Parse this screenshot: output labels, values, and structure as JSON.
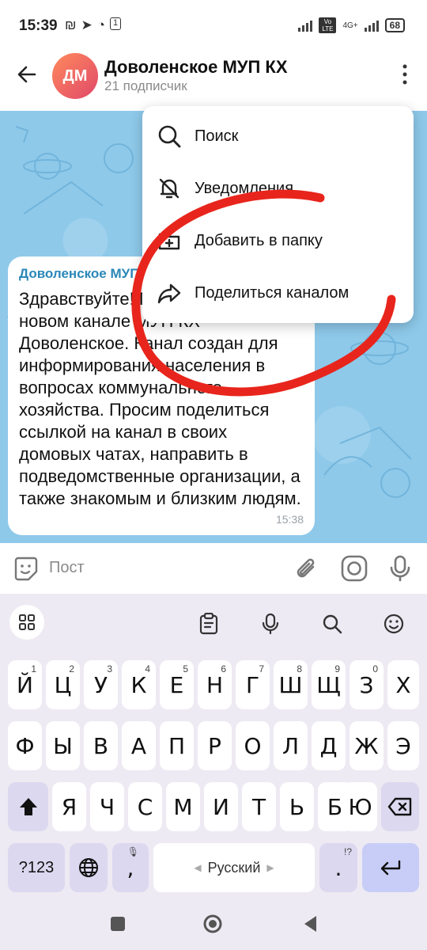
{
  "status_bar": {
    "time": "15:39",
    "battery": "68",
    "network": "4G+",
    "volte": "Vo LTE",
    "notification_count": "1"
  },
  "header": {
    "avatar_initials": "ДМ",
    "title": "Доволенское МУП КХ",
    "subtitle": "21 подписчик"
  },
  "menu": {
    "items": [
      {
        "label": "Поиск",
        "icon": "search-icon"
      },
      {
        "label": "Уведомления",
        "icon": "bell-off-icon"
      },
      {
        "label": "Добавить в папку",
        "icon": "folder-add-icon"
      },
      {
        "label": "Поделиться каналом",
        "icon": "share-icon"
      }
    ]
  },
  "message": {
    "author": "Доволенское МУП КХ",
    "text": "Здравствуйте! Приветствуем вас в новом канале МУП КХ Доволенское. Канал создан для информирования населения в вопросах коммунального хозяйства. Просим поделиться ссылкой на канал в своих домовых чатах, направить в подведомственные организации, а также знакомым и близким людям.",
    "time": "15:38"
  },
  "input": {
    "placeholder": "Пост"
  },
  "keyboard": {
    "row1": [
      {
        "k": "Й",
        "n": "1"
      },
      {
        "k": "Ц",
        "n": "2"
      },
      {
        "k": "У",
        "n": "3"
      },
      {
        "k": "К",
        "n": "4"
      },
      {
        "k": "Е",
        "n": "5"
      },
      {
        "k": "Н",
        "n": "6"
      },
      {
        "k": "Г",
        "n": "7"
      },
      {
        "k": "Ш",
        "n": "8"
      },
      {
        "k": "Щ",
        "n": "9"
      },
      {
        "k": "З",
        "n": "0"
      },
      {
        "k": "Х",
        "n": ""
      }
    ],
    "row2": [
      "Ф",
      "Ы",
      "В",
      "А",
      "П",
      "Р",
      "О",
      "Л",
      "Д",
      "Ж",
      "Э"
    ],
    "row3": [
      "Я",
      "Ч",
      "С",
      "М",
      "И",
      "Т",
      "Ь",
      "Б",
      "Ю"
    ],
    "symbols_label": "?123",
    "comma": ",",
    "space_label": "Русский",
    "period": ".",
    "period_hint": "!?"
  },
  "colors": {
    "accent": "#2a88b8",
    "chat_bg": "#8ec9ea",
    "annotation": "#e8251c",
    "enter_key": "#c7cdf6",
    "shift_key": "#dcd8f0"
  }
}
